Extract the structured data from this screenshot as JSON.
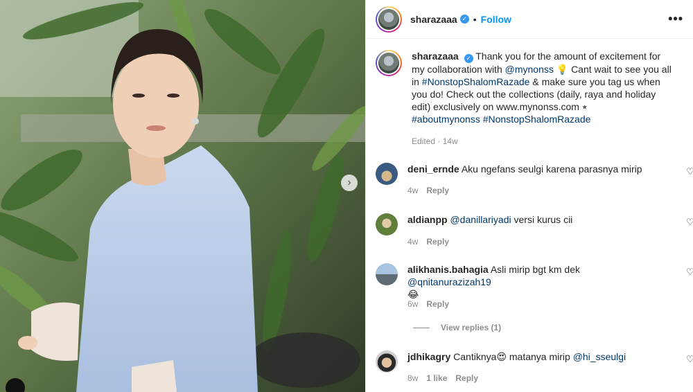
{
  "header": {
    "username": "sharazaaa",
    "separator": "•",
    "follow_label": "Follow",
    "more_icon": "•••"
  },
  "caption": {
    "username": "sharazaaa",
    "text_1": "Thank you for the amount of excitement for my collaboration with ",
    "mention_1": "@mynonss",
    "text_2": " 💡 Cant wait to see you all in ",
    "hashtag_1": "#NonstopShalomRazade",
    "text_3": " & make sure you tag us when you do! Check out the collections (daily, raya and holiday edit) exclusively on www.mynonss.com ⭒",
    "hashtag_2": "#aboutmynonss",
    "hashtag_3": "#NonstopShalomRazade",
    "edited": "Edited",
    "time": "14w"
  },
  "comments": [
    {
      "username": "deni_ernde",
      "text": "Aku ngefans seulgi karena parasnya mirip",
      "time": "4w",
      "reply": "Reply"
    },
    {
      "username": "aldianpp",
      "mention": "@danillariyadi",
      "text": " versi kurus cii",
      "time": "4w",
      "reply": "Reply"
    },
    {
      "username": "alikhanis.bahagia",
      "text": "Asli mirip bgt km dek ",
      "mention": "@qnitanurazizah19",
      "emoji": "😂",
      "time": "6w",
      "reply": "Reply",
      "view_replies": "View replies (1)"
    },
    {
      "username": "jdhikagry",
      "text": "Cantiknya😍 matanya mirip ",
      "mention": "@hi_sseulgi",
      "time": "8w",
      "likes": "1 like",
      "reply": "Reply"
    }
  ],
  "icons": {
    "verified": "verified-badge-icon",
    "heart": "heart-outline-icon",
    "next": "chevron-right-icon"
  },
  "colors": {
    "link": "#00376b",
    "follow": "#0095f6",
    "muted": "#8e8e8e"
  }
}
